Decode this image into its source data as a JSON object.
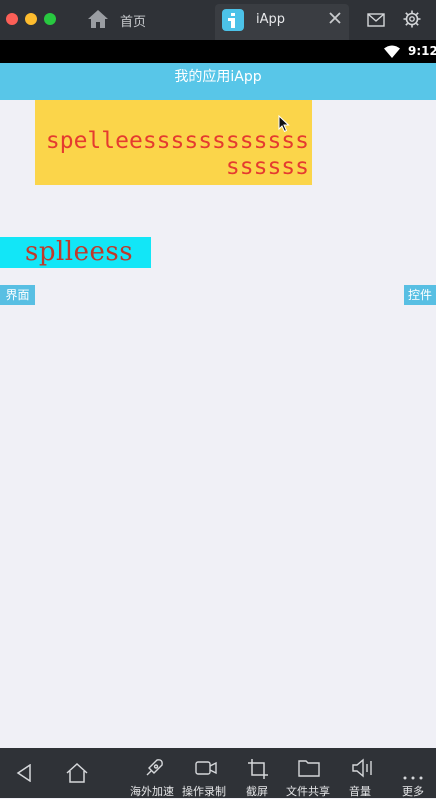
{
  "window": {
    "home_tab_label": "首页",
    "active_tab_label": "iApp"
  },
  "status_bar": {
    "time": "9:12"
  },
  "app_bar": {
    "title": "我的应用iApp"
  },
  "content": {
    "yellow_text": "spelleessssssssssssssssss",
    "cyan_text": "splleess",
    "left_button_label": "界面",
    "right_button_label": "控件"
  },
  "bottom_toolbar": {
    "items": [
      {
        "label": "",
        "icon": "back-icon"
      },
      {
        "label": "",
        "icon": "home-icon"
      },
      {
        "label": "海外加速",
        "icon": "rocket-icon"
      },
      {
        "label": "操作录制",
        "icon": "video-icon"
      },
      {
        "label": "截屏",
        "icon": "crop-icon"
      },
      {
        "label": "文件共享",
        "icon": "folder-icon"
      },
      {
        "label": "音量",
        "icon": "volume-icon"
      },
      {
        "label": "更多",
        "icon": "more-icon"
      }
    ]
  },
  "colors": {
    "appbar": "#58c6e8",
    "yellow_block": "#fbd54a",
    "cyan_block": "#12e6f7",
    "red_text": "#e53b2f",
    "button": "#58bfe3"
  }
}
